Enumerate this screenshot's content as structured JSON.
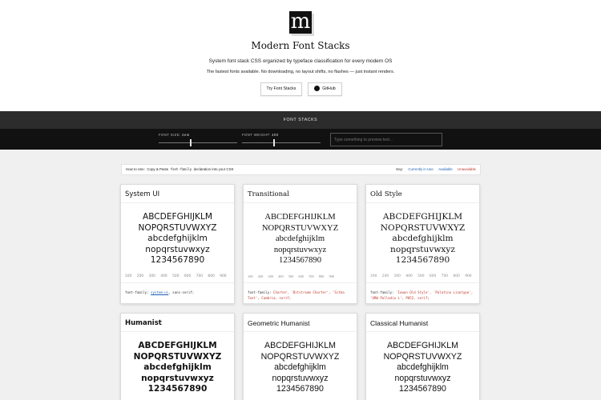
{
  "header": {
    "logo_letter": "m",
    "title": "Modern Font Stacks",
    "tagline": "System font stack CSS organized by typeface classification for every modern OS",
    "subline": "The fastest fonts available. No downloading, no layout shifts, no flashes — just instant renders.",
    "try_button": "Try Font Stacks",
    "github_button": "GitHub"
  },
  "toolbar": {
    "title": "FONT STACKS",
    "font_size_label": "FONT SIZE:",
    "font_size_value": "2em",
    "font_weight_label": "FONT WEIGHT:",
    "font_weight_value": "400",
    "font_size_level": 0.4,
    "font_weight_level": 0.4,
    "preview_placeholder": "Type something to preview text..."
  },
  "howto": {
    "prefix": "How to Use:",
    "instruction": "Copy & Paste",
    "code": "font-family",
    "suffix": "declaration into your CSS",
    "key_label": "Key:",
    "key_items": [
      "Currently in Use",
      "Available",
      "Unavailable"
    ]
  },
  "sample_lines": [
    "ABCDEFGHIJKLM",
    "NOPQRSTUVWXYZ",
    "abcdefghijklm",
    "nopqrstuvwxyz",
    "1234567890"
  ],
  "weights": "100 200 300 400 500 600 700 800 900",
  "cards": [
    {
      "title": "System UI",
      "css_prefix": "font-family:",
      "stack": "system-ui",
      "stack_rest": ", sans-serif;",
      "stack_line2": ""
    },
    {
      "title": "Transitional",
      "css_prefix": "font-family:",
      "stack": "Charter, 'Bitstream Charter', 'Sitka Text', Cambria, serif;",
      "stack_rest": "",
      "stack_line2": ""
    },
    {
      "title": "Old Style",
      "css_prefix": "font-family:",
      "stack": "'Iowan Old Style', 'Palatino Linotype', 'URW Palladio L', P052, serif;",
      "stack_rest": "",
      "stack_line2": ""
    },
    {
      "title": "Humanist"
    },
    {
      "title": "Geometric Humanist"
    },
    {
      "title": "Classical Humanist"
    }
  ],
  "colors": {
    "in_use": "#1a5fb4",
    "available": "#1a5fb4",
    "unavailable": "#c0392b",
    "toolbar_top": "#2c2c2c",
    "toolbar_bottom": "#111111",
    "content_bg": "#f0f0f0"
  }
}
